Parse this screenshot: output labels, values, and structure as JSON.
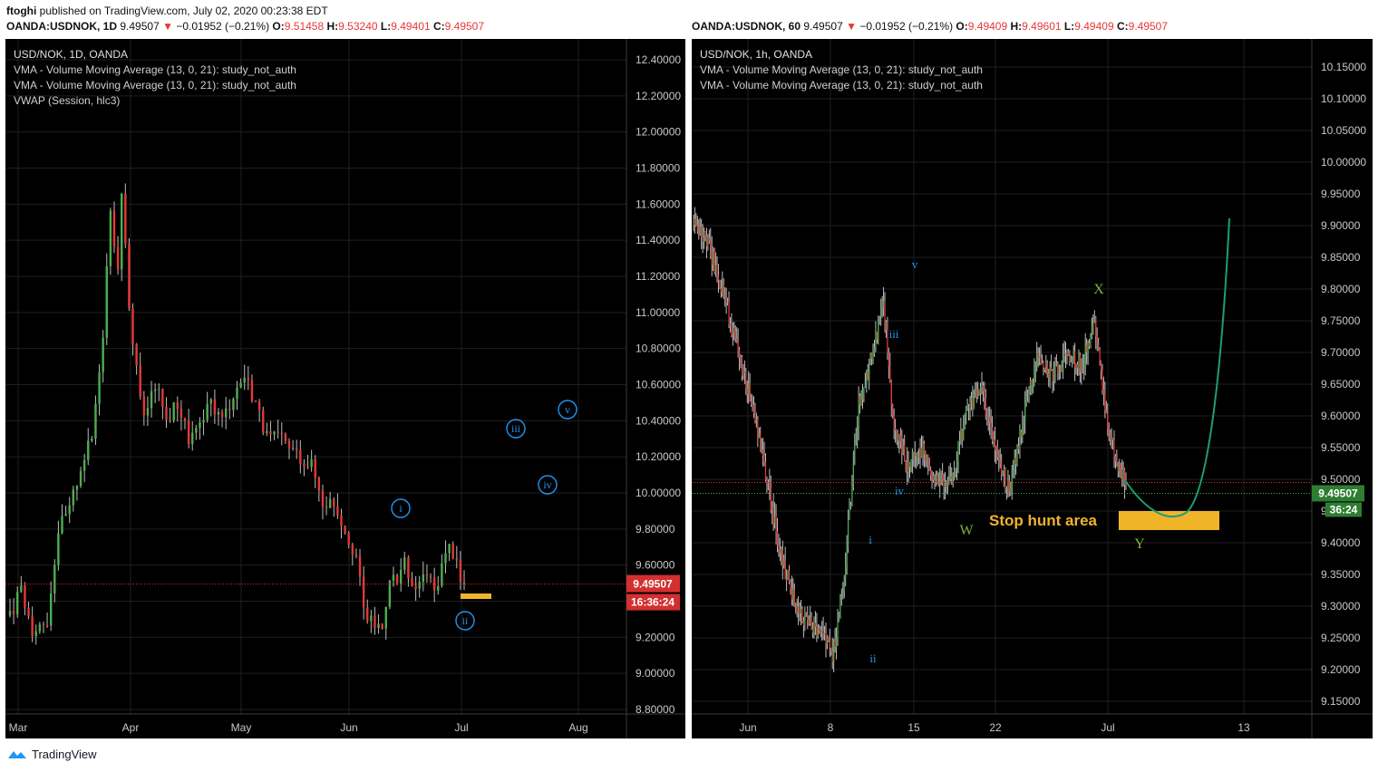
{
  "header": {
    "author": "ftoghi",
    "published_text": "published on TradingView.com, July 02, 2020 00:23:38 EDT",
    "left_quote": {
      "symbol": "OANDA:USDNOK, 1D",
      "last": "9.49507",
      "arrow": "▼",
      "change": "−0.01952 (−0.21%)",
      "o_label": "O:",
      "o": "9.51458",
      "h_label": "H:",
      "h": "9.53240",
      "l_label": "L:",
      "l": "9.49401",
      "c_label": "C:",
      "c": "9.49507"
    },
    "right_quote": {
      "symbol": "OANDA:USDNOK, 60",
      "last": "9.49507",
      "arrow": "▼",
      "change": "−0.01952 (−0.21%)",
      "o_label": "O:",
      "o": "9.49409",
      "h_label": "H:",
      "h": "9.49601",
      "l_label": "L:",
      "l": "9.49409",
      "c_label": "C:",
      "c": "9.49507"
    }
  },
  "footer": {
    "brand": "TradingView"
  },
  "colors": {
    "bg": "#000000",
    "up": "#26a69a",
    "down": "#e53935",
    "up_candle": "#4caf50",
    "label_blue": "#2196f3",
    "label_green": "#7cb342",
    "curve": "#1b9e77",
    "box": "#f0b429",
    "price_tag": "#d32f2f",
    "price_tag_right": "#2e7d32",
    "grid": "#1f1f1f",
    "axis_text": "#c8c8c8"
  },
  "chart_data": [
    {
      "type": "candlestick",
      "title": "USD/NOK, 1D, OANDA",
      "indicators": [
        "VMA - Volume Moving Average (13, 0, 21): study_not_auth",
        "VMA - Volume Moving Average (13, 0, 21): study_not_auth",
        "VWAP (Session, hlc3)"
      ],
      "y_ticks": [
        "12.40000",
        "12.20000",
        "12.00000",
        "11.80000",
        "11.60000",
        "11.40000",
        "11.20000",
        "11.00000",
        "10.80000",
        "10.60000",
        "10.40000",
        "10.20000",
        "10.00000",
        "9.80000",
        "9.60000",
        "9.40000",
        "9.20000",
        "9.00000",
        "8.80000"
      ],
      "ylim": [
        8.8,
        12.4
      ],
      "x_ticks": [
        "Mar",
        "Apr",
        "May",
        "Jun",
        "Jul",
        "Aug"
      ],
      "last_price": "9.49507",
      "countdown": "16:36:24",
      "series": {
        "start_day": 0,
        "step_days": 1,
        "points": [
          {
            "d": 0,
            "c": 9.32
          },
          {
            "d": 3,
            "c": 9.45
          },
          {
            "d": 6,
            "c": 9.25
          },
          {
            "d": 9,
            "c": 9.28
          },
          {
            "d": 10,
            "c": 9.3
          },
          {
            "d": 13,
            "c": 9.8
          },
          {
            "d": 16,
            "c": 9.9
          },
          {
            "d": 19,
            "c": 10.15
          },
          {
            "d": 22,
            "c": 10.3
          },
          {
            "d": 25,
            "c": 10.9
          },
          {
            "d": 27,
            "c": 11.6
          },
          {
            "d": 29,
            "c": 11.2
          },
          {
            "d": 30,
            "c": 11.7
          },
          {
            "d": 32,
            "c": 11.0
          },
          {
            "d": 34,
            "c": 10.7
          },
          {
            "d": 36,
            "c": 10.4
          },
          {
            "d": 39,
            "c": 10.6
          },
          {
            "d": 42,
            "c": 10.4
          },
          {
            "d": 45,
            "c": 10.5
          },
          {
            "d": 48,
            "c": 10.3
          },
          {
            "d": 51,
            "c": 10.35
          },
          {
            "d": 54,
            "c": 10.5
          },
          {
            "d": 57,
            "c": 10.4
          },
          {
            "d": 60,
            "c": 10.55
          },
          {
            "d": 63,
            "c": 10.65
          },
          {
            "d": 66,
            "c": 10.5
          },
          {
            "d": 69,
            "c": 10.3
          },
          {
            "d": 72,
            "c": 10.3
          },
          {
            "d": 75,
            "c": 10.25
          },
          {
            "d": 78,
            "c": 10.2
          },
          {
            "d": 81,
            "c": 10.15
          },
          {
            "d": 84,
            "c": 9.95
          },
          {
            "d": 87,
            "c": 9.95
          },
          {
            "d": 90,
            "c": 9.8
          },
          {
            "d": 93,
            "c": 9.65
          },
          {
            "d": 95,
            "c": 9.35
          },
          {
            "d": 97,
            "c": 9.28
          },
          {
            "d": 100,
            "c": 9.25
          },
          {
            "d": 102,
            "c": 9.55
          },
          {
            "d": 104,
            "c": 9.5
          },
          {
            "d": 106,
            "c": 9.6
          },
          {
            "d": 108,
            "c": 9.45
          },
          {
            "d": 110,
            "c": 9.5
          },
          {
            "d": 112,
            "c": 9.55
          },
          {
            "d": 114,
            "c": 9.45
          },
          {
            "d": 116,
            "c": 9.6
          },
          {
            "d": 118,
            "c": 9.7
          },
          {
            "d": 120,
            "c": 9.65
          },
          {
            "d": 121,
            "c": 9.5
          },
          {
            "d": 122,
            "c": 9.495
          }
        ]
      },
      "wave_labels": [
        "i",
        "ii",
        "iii",
        "iv",
        "v"
      ]
    },
    {
      "type": "candlestick",
      "title": "USD/NOK, 1h, OANDA",
      "indicators": [
        "VMA - Volume Moving Average (13, 0, 21): study_not_auth",
        "VMA - Volume Moving Average (13, 0, 21): study_not_auth"
      ],
      "y_ticks": [
        "10.15000",
        "10.10000",
        "10.05000",
        "10.00000",
        "9.95000",
        "9.90000",
        "9.85000",
        "9.80000",
        "9.75000",
        "9.70000",
        "9.65000",
        "9.60000",
        "9.55000",
        "9.50000",
        "9.45000",
        "9.40000",
        "9.35000",
        "9.30000",
        "9.25000",
        "9.20000",
        "9.15000"
      ],
      "ylim": [
        9.13,
        10.18
      ],
      "x_ticks": [
        "Jun",
        "8",
        "15",
        "22",
        "Jul",
        "13"
      ],
      "last_price": "9.49507",
      "countdown": "36:24",
      "series": {
        "points": [
          {
            "d": 0,
            "c": 9.9
          },
          {
            "d": 1.5,
            "c": 9.87
          },
          {
            "d": 3,
            "c": 9.8
          },
          {
            "d": 4.5,
            "c": 9.7
          },
          {
            "d": 6,
            "c": 9.62
          },
          {
            "d": 7.5,
            "c": 9.5
          },
          {
            "d": 9,
            "c": 9.38
          },
          {
            "d": 10.5,
            "c": 9.3
          },
          {
            "d": 12,
            "c": 9.27
          },
          {
            "d": 13.5,
            "c": 9.25
          },
          {
            "d": 14.3,
            "c": 9.22
          },
          {
            "d": 15.5,
            "c": 9.35
          },
          {
            "d": 17,
            "c": 9.62
          },
          {
            "d": 18.5,
            "c": 9.7
          },
          {
            "d": 19.5,
            "c": 9.79
          },
          {
            "d": 20.5,
            "c": 9.6
          },
          {
            "d": 22,
            "c": 9.52
          },
          {
            "d": 23.5,
            "c": 9.55
          },
          {
            "d": 25,
            "c": 9.5
          },
          {
            "d": 26.5,
            "c": 9.5
          },
          {
            "d": 28,
            "c": 9.6
          },
          {
            "d": 29.5,
            "c": 9.65
          },
          {
            "d": 31,
            "c": 9.55
          },
          {
            "d": 32.5,
            "c": 9.48
          },
          {
            "d": 34,
            "c": 9.6
          },
          {
            "d": 35.5,
            "c": 9.7
          },
          {
            "d": 37,
            "c": 9.66
          },
          {
            "d": 38.5,
            "c": 9.7
          },
          {
            "d": 40,
            "c": 9.68
          },
          {
            "d": 41.3,
            "c": 9.75
          },
          {
            "d": 42.5,
            "c": 9.6
          },
          {
            "d": 43.5,
            "c": 9.52
          },
          {
            "d": 44.5,
            "c": 9.495
          }
        ]
      },
      "wave_labels": [
        "i",
        "ii",
        "iii",
        "iv",
        "v",
        "W",
        "X",
        "Y"
      ],
      "annotation": "Stop hunt area"
    }
  ]
}
